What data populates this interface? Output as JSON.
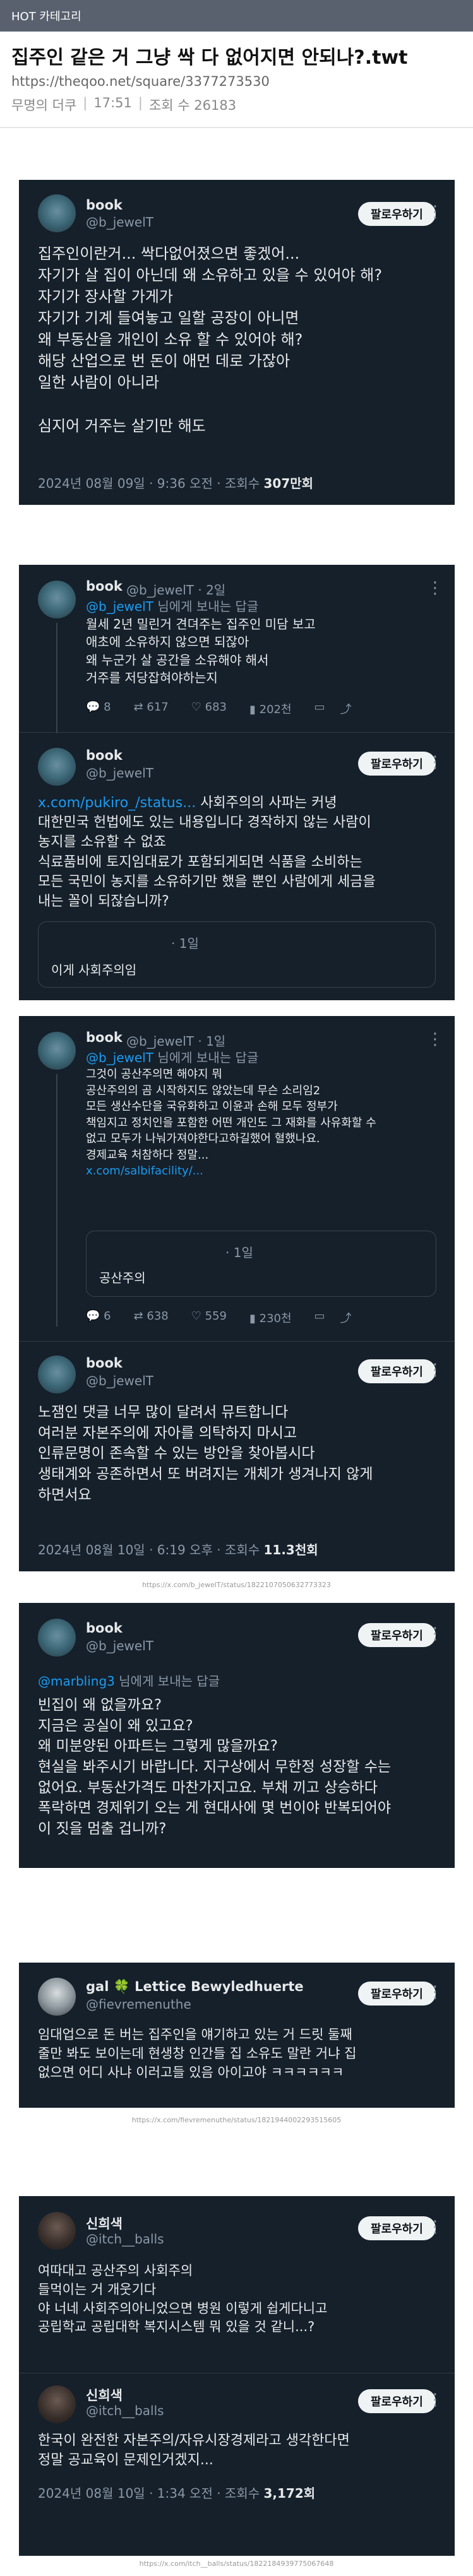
{
  "header": {
    "category": "HOT 카테고리"
  },
  "post": {
    "title": "집주인 같은 거 그냥 싹 다 없어지면 안되나?.twt",
    "url": "https://theqoo.net/square/3377273530",
    "author": "무명의 더쿠",
    "time": "17:51",
    "views": "조회 수 26183"
  },
  "follow_label": "팔로우하기",
  "tweet1": {
    "name": "book",
    "handle": "@b_jewelT",
    "lines": [
      "집주인이란거... 싹다없어졌으면 좋겠어...",
      "자기가 살 집이 아닌데 왜 소유하고 있을 수 있어야 해?",
      "자기가 장사할 가게가",
      "자기가 기계 들여놓고 일할 공장이 아니면",
      "왜 부동산을 개인이 소유 할 수 있어야 해?",
      "해당 산업으로 번 돈이 애먼 데로 가잖아",
      "일한 사람이 아니라",
      "",
      "심지어 거주는 살기만 해도"
    ],
    "date": "2024년 08월 09일 · 9:36 오전 · 조회수 ",
    "views": "307만회"
  },
  "tweet2": {
    "name": "book",
    "handle": "@b_jewelT · 2일",
    "reply_to": "@b_jewelT",
    "reply_suffix": " 님에게 보내는 답글",
    "lines": [
      "월세 2년 밀린거 견뎌주는 집주인 미담 보고",
      "애초에 소유하지 않으면 되잖아",
      "왜 누군가 살 공간을 소유해야 해서",
      "거주를 저당잡혀야하는지"
    ],
    "replies": "8",
    "retweets": "617",
    "likes": "683",
    "views": "202천"
  },
  "tweet3": {
    "name": "book",
    "handle": "@b_jewelT",
    "link": "x.com/pukiro_/status...",
    "lines": [
      "사회주의의 사파는 커녕",
      "대한민국 헌법에도 있는 내용입니다 경작하지 않는 사람이",
      "농지를 소유할 수 없죠",
      "식료품비에 토지임대료가 포함되게되면 식품을 소비하는",
      "모든 국민이 농지를 소유하기만 했을 뿐인 사람에게 세금을",
      "내는 꼴이 되잖습니까?"
    ],
    "quote_meta": "· 1일",
    "quote_text": "이게 사회주의임"
  },
  "tweet4": {
    "name": "book",
    "handle": "@b_jewelT · 1일",
    "reply_to": "@b_jewelT",
    "reply_suffix": " 님에게 보내는 답글",
    "lines": [
      "그것이 공산주의면 해야지 뭐",
      "공산주의의 곰 시작하지도 않았는데 무슨 소리임2",
      "모든 생산수단을 국유화하고 이윤과 손해 모두 정부가",
      "책임지고 정치인을 포함한 어떤 개인도 그 재화를 사유화할 수",
      "없고 모두가 나눠가져야한다고하길했어 혈했나요.",
      "경제교육 처참하다 정말..."
    ],
    "link": "x.com/salbifacility/...",
    "quote_meta": "· 1일",
    "quote_text": "공산주의",
    "replies": "6",
    "retweets": "638",
    "likes": "559",
    "views": "230천"
  },
  "tweet5": {
    "name": "book",
    "handle": "@b_jewelT",
    "lines": [
      "노잼인 댓글 너무 많이 달려서 뮤트합니다",
      "여러분 자본주의에 자아를 의탁하지 마시고",
      "인류문명이 존속할 수 있는 방안을 찾아봅시다",
      "생태계와 공존하면서 또 버려지는 개체가 생겨나지 않게",
      "하면서요"
    ],
    "date": "2024년 08월 10일 · 6:19 오후 · 조회수 ",
    "views": "11.3천회",
    "src": "https://x.com/b_jewelT/status/1822107050632773323"
  },
  "tweet6": {
    "name": "book",
    "handle": "@b_jewelT",
    "reply_to": "@marbling3",
    "reply_suffix": " 님에게 보내는 답글",
    "lines": [
      "빈집이 왜 없을까요?",
      "지금은 공실이 왜 있고요?",
      "왜 미분양된 아파트는 그렇게 많을까요?",
      "현실을 봐주시기 바랍니다. 지구상에서 무한정 성장할 수는",
      "없어요. 부동산가격도 마찬가지고요. 부채 끼고 상승하다",
      "폭락하면 경제위기 오는 게 현대사에 몇 번이야 반복되어야",
      "이 짓을 멈출 겁니까?"
    ]
  },
  "tweet7": {
    "name": "gal 🍀 Lettice Bewyledhuerte",
    "handle": "@fievremenuthe",
    "lines": [
      "임대업으로 돈 버는 집주인을 얘기하고 있는 거 드릿 둘째",
      "줄만 봐도 보이는데 현생창 인간들 집 소유도 말란 거냐 집",
      "없으면 어디 사냐 이러고들 있음 아이고야 ㅋㅋㅋㅋㅋㅋ"
    ],
    "src": "https://x.com/fievremenuthe/status/1821944002293515605"
  },
  "tweet8": {
    "name": "신희색",
    "handle": "@itch__balls",
    "lines": [
      "여따대고 공산주의 사회주의",
      "들먹이는 거 개웃기다",
      "야 너네 사회주의아니었으면 병원 이렇게 쉽게다니고",
      "공립학교 공립대학 복지시스템 뭐 있을 것 같니...?"
    ]
  },
  "tweet9": {
    "name": "신희색",
    "handle": "@itch__balls",
    "lines": [
      "한국이 완전한 자본주의/자유시장경제라고 생각한다면",
      "정말 공교육이 문제인거겠지..."
    ],
    "date": "2024년 08월 10일 · 1:34 오전 · 조회수 ",
    "views": "3,172회",
    "src": "https://x.com/itch__balls/status/1822184939775067648"
  }
}
